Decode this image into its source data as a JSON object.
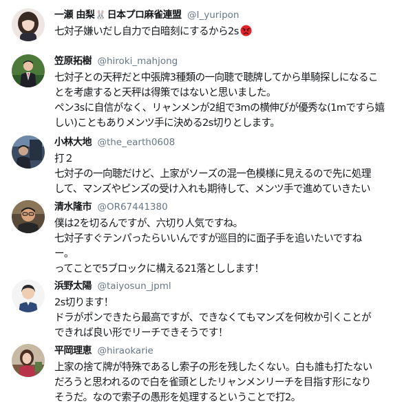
{
  "tweets": [
    {
      "name": "一瀬 由梨",
      "name_suffix": "日本プロ麻雀連盟",
      "emoji_in_name": "🐰",
      "handle": "@I_yuripon",
      "lines": [
        "七対子嫌いだし自力で白暗刻にするから2s"
      ],
      "trailing_emoji": "angry-face-emoji",
      "avatar_icon": "profile-photo-woman-long-hair"
    },
    {
      "name": "笠原拓樹",
      "handle": "@hiroki_mahjong",
      "lines": [
        "七対子との天秤だと中張牌3種類の一向聴で聴牌してから単騎探しになるこ",
        "とを考慮すると天秤は得策ではないと思いました。",
        "ペン3sに自信がなく、リャンメンが2組で3mの横伸びが優秀な(1mですら嬉",
        "しい)こともありメンツ手に決める2s切りとします。"
      ],
      "avatar_icon": "profile-photo-man-suit"
    },
    {
      "name": "小林大地",
      "handle": "@the_earth0608",
      "lines": [
        "打２",
        "七対子の一向聴だけど、上家がソーズの混一色模様に見えるので先に処理",
        "して、マンズやピンズの受け入れも期待して、メンツ手で進めていきたい"
      ],
      "avatar_icon": "profile-photo-dark-scene"
    },
    {
      "name": "清水隆市",
      "handle": "@OR67441380",
      "lines": [
        "僕は2を切るんですが、六切り人気ですね。",
        "七対子すぐテンパったらいいんですが巡目的に面子手を追いたいですね",
        "ー。",
        "ってことで5ブロックに構える21落としします！"
      ],
      "avatar_icon": "profile-photo-man-glasses"
    },
    {
      "name": "浜野太陽",
      "handle": "@taiyosun_jpml",
      "lines": [
        "2s切ります！",
        "ドラがポンできたら最高ですが、できなくてもマンズを何枚か引くことが",
        "できれば良い形でリーチできそうです！"
      ],
      "avatar_icon": "profile-photo-man-white-background"
    },
    {
      "name": "平岡理恵",
      "handle": "@hiraokarie",
      "lines": [
        "上家の捨て牌が特殊であるし索子の形を残したくない。白も誰も打たない",
        "だろうと思われるので白を雀頭としたリャンメンリーチを目指す形になり",
        "そうだ。なので索子の愚形を処理するということで打2。"
      ],
      "avatar_icon": "profile-photo-woman-indoor"
    }
  ]
}
